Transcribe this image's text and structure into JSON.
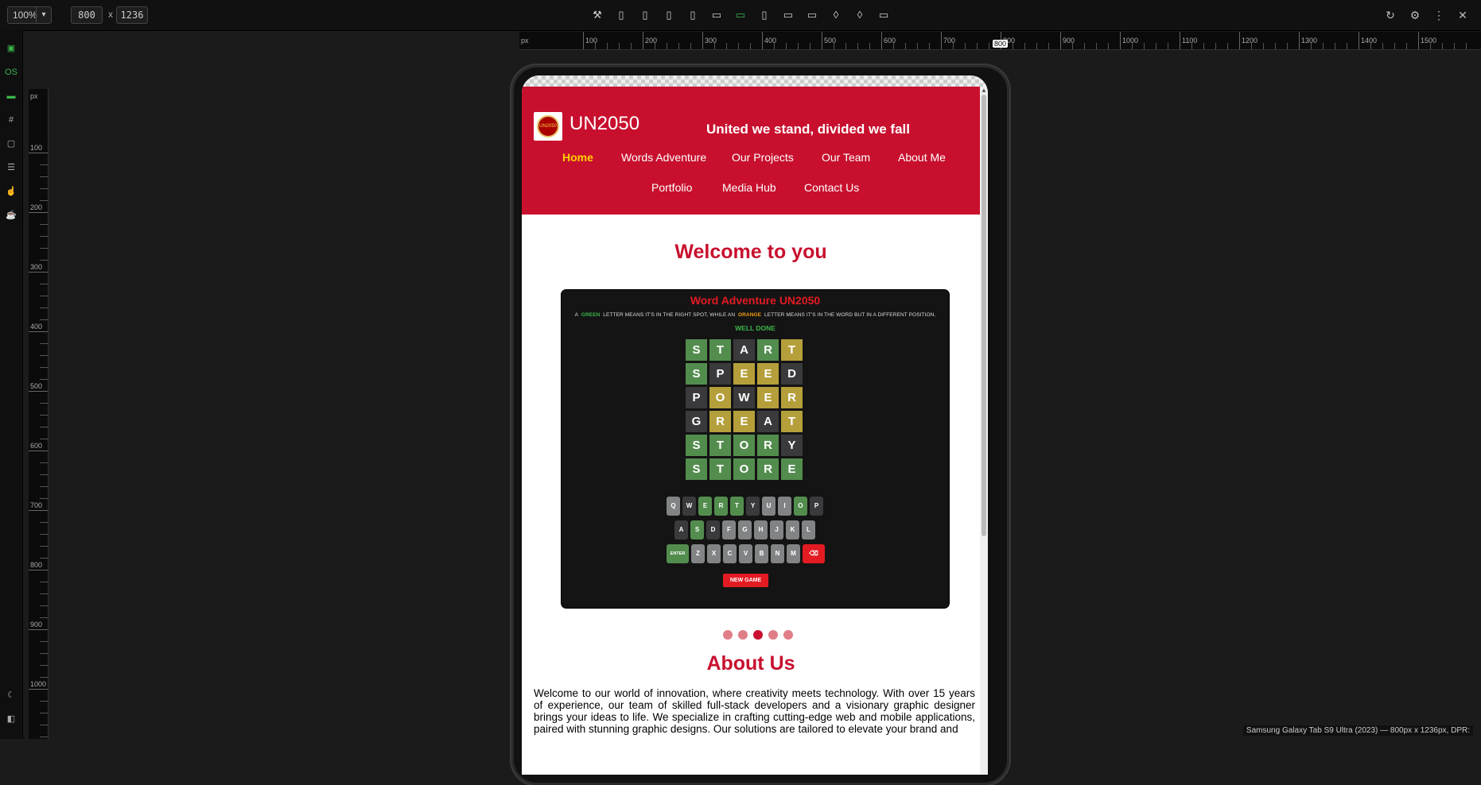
{
  "toolbar": {
    "zoom": "100%",
    "width": "800",
    "height": "1236",
    "x_label": "x",
    "devices": [
      "tools-icon",
      "phone-icon",
      "phone-icon",
      "phone-icon",
      "phone-icon",
      "tablet-icon",
      "tablet-icon",
      "tablet-icon",
      "laptop-icon",
      "laptop-icon",
      "watch-icon",
      "watch-icon",
      "desktop-icon"
    ]
  },
  "ruler": {
    "h_unit": "px",
    "h_labels": [
      "100",
      "200",
      "300",
      "400",
      "500",
      "600",
      "700",
      "800",
      "900",
      "1000",
      "1100",
      "1200",
      "1300",
      "1400",
      "1500"
    ],
    "h_marker": "800",
    "v_unit": "px",
    "v_labels": [
      "100",
      "200",
      "300",
      "400",
      "500",
      "600",
      "700",
      "800",
      "900",
      "1000"
    ]
  },
  "rail": {
    "os_label": "OS"
  },
  "site": {
    "brand": "UN2050",
    "logo_text": "UN2050",
    "tagline": "United we stand, divided we fall",
    "nav": [
      "Home",
      "Words Adventure",
      "Our Projects",
      "Our Team",
      "About Me",
      "Portfolio",
      "Media Hub",
      "Contact Us"
    ],
    "welcome": "Welcome to you",
    "game": {
      "title": "Word Adventure UN2050",
      "instr_a": "A",
      "instr_green": "GREEN",
      "instr_mid": "LETTER MEANS IT'S IN THE RIGHT SPOT, WHILE AN",
      "instr_orange": "ORANGE",
      "instr_end": "LETTER MEANS IT'S IN THE WORD BUT IN A DIFFERENT POSITION.",
      "status": "WELL DONE",
      "rows": [
        {
          "letters": [
            "S",
            "T",
            "A",
            "R",
            "T"
          ],
          "states": [
            "g",
            "g",
            "d",
            "g",
            "y"
          ]
        },
        {
          "letters": [
            "S",
            "P",
            "E",
            "E",
            "D"
          ],
          "states": [
            "g",
            "d",
            "y",
            "y",
            "d"
          ]
        },
        {
          "letters": [
            "P",
            "O",
            "W",
            "E",
            "R"
          ],
          "states": [
            "d",
            "y",
            "d",
            "y",
            "y"
          ]
        },
        {
          "letters": [
            "G",
            "R",
            "E",
            "A",
            "T"
          ],
          "states": [
            "d",
            "y",
            "y",
            "d",
            "y"
          ]
        },
        {
          "letters": [
            "S",
            "T",
            "O",
            "R",
            "Y"
          ],
          "states": [
            "g",
            "g",
            "g",
            "g",
            "d"
          ]
        },
        {
          "letters": [
            "S",
            "T",
            "O",
            "R",
            "E"
          ],
          "states": [
            "g",
            "g",
            "g",
            "g",
            "g"
          ]
        }
      ],
      "keyboard": [
        {
          "keys": [
            "Q",
            "W",
            "E",
            "R",
            "T",
            "Y",
            "U",
            "I",
            "O",
            "P"
          ],
          "states": [
            "l",
            "d",
            "g",
            "g",
            "g",
            "d",
            "l",
            "l",
            "g",
            "d"
          ]
        },
        {
          "keys": [
            "A",
            "S",
            "D",
            "F",
            "G",
            "H",
            "J",
            "K",
            "L"
          ],
          "states": [
            "d",
            "g",
            "d",
            "l",
            "l",
            "l",
            "l",
            "l",
            "l"
          ]
        },
        {
          "keys": [
            "ENTER",
            "Z",
            "X",
            "C",
            "V",
            "B",
            "N",
            "M",
            "⌫"
          ],
          "states": [
            "g",
            "l",
            "l",
            "l",
            "l",
            "l",
            "l",
            "l",
            "r"
          ]
        }
      ],
      "new_game": "NEW GAME"
    },
    "carousel": {
      "count": 5,
      "active": 2
    },
    "about_title": "About Us",
    "about_text": "Welcome to our world of innovation, where creativity meets technology. With over 15 years of experience, our team of skilled full-stack developers and a visionary graphic designer brings your ideas to life. We specialize in crafting cutting-edge web and mobile applications, paired with stunning graphic designs. Our solutions are tailored to elevate your brand and"
  },
  "colors": {
    "brand_red": "#c8102e",
    "tile_green": "#538d4e",
    "tile_yellow": "#b59f3b",
    "tile_dark": "#3a3a3c",
    "key_light": "#818384",
    "key_red": "#e31b23",
    "nav_active": "#ffd000"
  },
  "statusbar": "Samsung Galaxy Tab S9 Ultra (2023) — 800px x 1236px, DPR:"
}
